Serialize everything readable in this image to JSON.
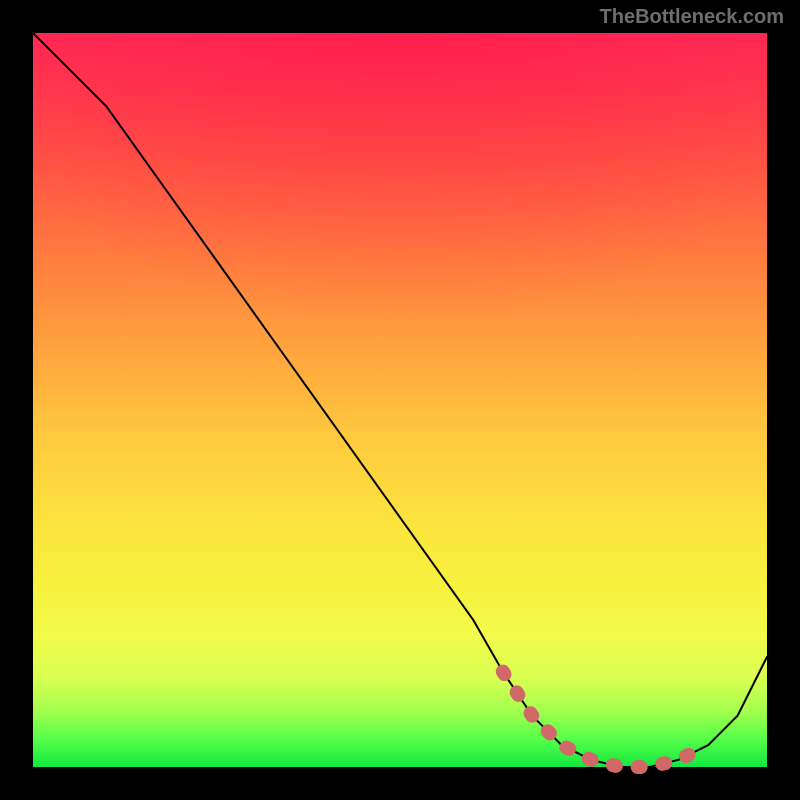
{
  "watermark": "TheBottleneck.com",
  "chart_data": {
    "type": "line",
    "title": "",
    "xlabel": "",
    "ylabel": "",
    "xlim": [
      0,
      100
    ],
    "ylim": [
      0,
      100
    ],
    "series": [
      {
        "name": "main-curve",
        "x": [
          0,
          5,
          10,
          15,
          20,
          25,
          30,
          35,
          40,
          45,
          50,
          55,
          60,
          64,
          68,
          72,
          76,
          80,
          84,
          88,
          92,
          96,
          100
        ],
        "values": [
          100,
          95,
          90,
          83,
          76,
          69,
          62,
          55,
          48,
          41,
          34,
          27,
          20,
          13,
          7,
          3,
          1,
          0,
          0,
          1,
          3,
          7,
          15
        ],
        "stroke": "#000000",
        "stroke_width": 2
      },
      {
        "name": "highlight-band",
        "x": [
          64,
          68,
          72,
          76,
          80,
          84,
          88,
          92
        ],
        "values": [
          13,
          7,
          3,
          1,
          0,
          0,
          1,
          3
        ],
        "stroke": "#d46a6a",
        "stroke_width": 12,
        "dotted": true
      }
    ],
    "background_gradient": {
      "stops": [
        {
          "pos": 0.0,
          "color": "#ff2a55"
        },
        {
          "pos": 0.18,
          "color": "#ff5544"
        },
        {
          "pos": 0.42,
          "color": "#ffa03e"
        },
        {
          "pos": 0.66,
          "color": "#fbe23e"
        },
        {
          "pos": 0.88,
          "color": "#d7ff52"
        },
        {
          "pos": 1.0,
          "color": "#12e83e"
        }
      ]
    }
  }
}
